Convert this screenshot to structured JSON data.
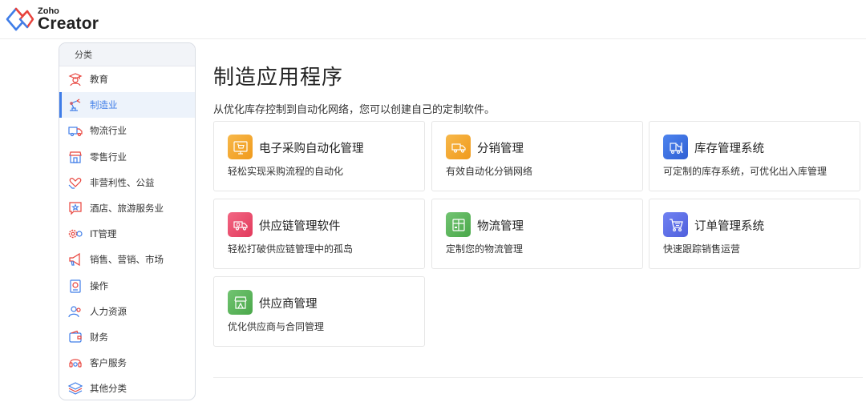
{
  "brand": {
    "small": "Zoho",
    "big": "Creator"
  },
  "sidebar": {
    "header": "分类",
    "items": [
      {
        "label": "教育",
        "icon": "graduation-icon",
        "active": false
      },
      {
        "label": "制造业",
        "icon": "robot-arm-icon",
        "active": true
      },
      {
        "label": "物流行业",
        "icon": "truck-icon",
        "active": false
      },
      {
        "label": "零售行业",
        "icon": "storefront-icon",
        "active": false
      },
      {
        "label": "非营利性、公益",
        "icon": "heart-hand-icon",
        "active": false
      },
      {
        "label": "酒店、旅游服务业",
        "icon": "star-bubble-icon",
        "active": false
      },
      {
        "label": "IT管理",
        "icon": "gears-icon",
        "active": false
      },
      {
        "label": "销售、营销、市场",
        "icon": "megaphone-icon",
        "active": false
      },
      {
        "label": "操作",
        "icon": "clipboard-gear-icon",
        "active": false
      },
      {
        "label": "人力资源",
        "icon": "people-icon",
        "active": false
      },
      {
        "label": "财务",
        "icon": "wallet-icon",
        "active": false
      },
      {
        "label": "客户服务",
        "icon": "headset-icon",
        "active": false
      },
      {
        "label": "其他分类",
        "icon": "layers-icon",
        "active": false
      }
    ]
  },
  "main": {
    "title": "制造应用程序",
    "subtitle": "从优化库存控制到自动化网络，您可以创建自己的定制软件。",
    "cards": [
      {
        "title": "电子采购自动化管理",
        "desc": "轻松实现采购流程的自动化",
        "icon": "cart-icon",
        "color": "#f5a623"
      },
      {
        "title": "分销管理",
        "desc": "有效自动化分销网络",
        "icon": "delivery-truck-icon",
        "color": "#f5a623"
      },
      {
        "title": "库存管理系统",
        "desc": "可定制的库存系统，可优化出入库管理",
        "icon": "forklift-icon",
        "color": "#3b6fe0"
      },
      {
        "title": "供应链管理软件",
        "desc": "轻松打破供应链管理中的孤岛",
        "icon": "supply-truck-icon",
        "color": "#ec4a6a"
      },
      {
        "title": "物流管理",
        "desc": "定制您的物流管理",
        "icon": "package-icon",
        "color": "#5cb85c"
      },
      {
        "title": "订单管理系统",
        "desc": "快速跟踪销售运营",
        "icon": "order-cart-icon",
        "color": "#5b6be8"
      },
      {
        "title": "供应商管理",
        "desc": "优化供应商与合同管理",
        "icon": "vendor-store-icon",
        "color": "#5cb85c"
      }
    ]
  }
}
